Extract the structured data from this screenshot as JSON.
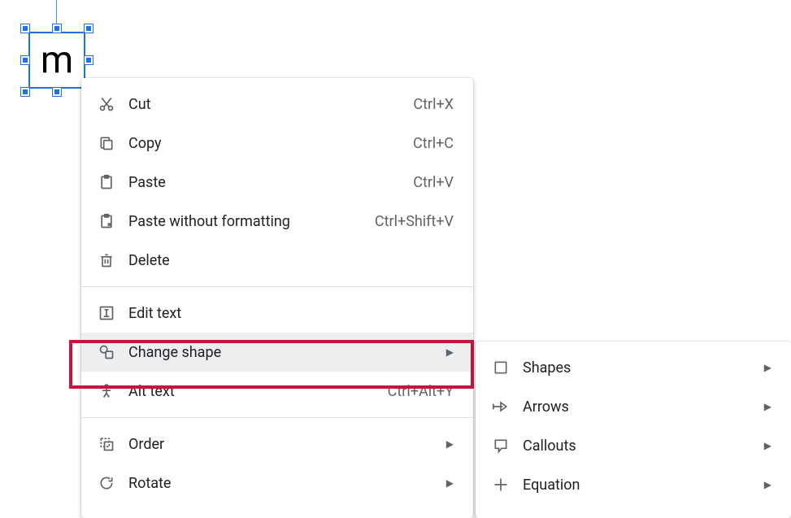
{
  "shape": {
    "text": "m"
  },
  "menu": {
    "cut": {
      "label": "Cut",
      "shortcut": "Ctrl+X"
    },
    "copy": {
      "label": "Copy",
      "shortcut": "Ctrl+C"
    },
    "paste": {
      "label": "Paste",
      "shortcut": "Ctrl+V"
    },
    "pastePlain": {
      "label": "Paste without formatting",
      "shortcut": "Ctrl+Shift+V"
    },
    "delete": {
      "label": "Delete"
    },
    "editText": {
      "label": "Edit text"
    },
    "changeShape": {
      "label": "Change shape"
    },
    "altText": {
      "label": "Alt text",
      "shortcut": "Ctrl+Alt+Y"
    },
    "order": {
      "label": "Order"
    },
    "rotate": {
      "label": "Rotate"
    }
  },
  "submenu": {
    "shapes": {
      "label": "Shapes"
    },
    "arrows": {
      "label": "Arrows"
    },
    "callouts": {
      "label": "Callouts"
    },
    "equation": {
      "label": "Equation"
    }
  }
}
